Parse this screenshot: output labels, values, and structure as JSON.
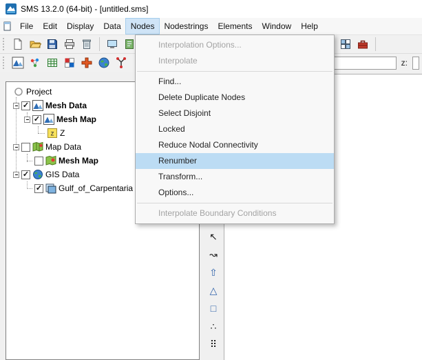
{
  "titlebar": {
    "title": "SMS 13.2.0 (64-bit) - [untitled.sms]"
  },
  "menubar": {
    "items": [
      "File",
      "Edit",
      "Display",
      "Data",
      "Nodes",
      "Nodestrings",
      "Elements",
      "Window",
      "Help"
    ]
  },
  "nodes_menu": {
    "items": [
      {
        "label": "Interpolation Options...",
        "state": "disabled"
      },
      {
        "label": "Interpolate",
        "state": "disabled"
      },
      {
        "label": "Find...",
        "state": "normal"
      },
      {
        "label": "Delete Duplicate Nodes",
        "state": "normal"
      },
      {
        "label": "Select Disjoint",
        "state": "normal"
      },
      {
        "label": "Locked",
        "state": "normal"
      },
      {
        "label": "Reduce Nodal Connectivity",
        "state": "normal"
      },
      {
        "label": "Renumber",
        "state": "highlighted"
      },
      {
        "label": "Transform...",
        "state": "normal"
      },
      {
        "label": "Options...",
        "state": "normal"
      },
      {
        "label": "Interpolate Boundary Conditions",
        "state": "disabled"
      }
    ]
  },
  "toolbar_right": {
    "z_label": "z:"
  },
  "tree": {
    "root": "Project",
    "items": [
      {
        "label": "Mesh Data",
        "checked": true,
        "bold": true
      },
      {
        "label": "Mesh Map",
        "checked": true,
        "bold": true
      },
      {
        "label": "Z",
        "checked": null,
        "bold": false
      },
      {
        "label": "Map Data",
        "checked": false,
        "bold": false
      },
      {
        "label": "Mesh Map",
        "checked": false,
        "bold": true
      },
      {
        "label": "GIS Data",
        "checked": true,
        "bold": false
      },
      {
        "label": "Gulf_of_Carpentaria",
        "checked": true,
        "bold": false
      }
    ]
  },
  "palette": {
    "tools": [
      {
        "name": "select-arrow-tool",
        "glyph": "↖"
      },
      {
        "name": "select-nodestring-tool",
        "glyph": "↝"
      },
      {
        "name": "create-node-tool",
        "glyph": "⇧"
      },
      {
        "name": "create-triangle-tool",
        "glyph": "△"
      },
      {
        "name": "create-quad-tool",
        "glyph": "□"
      },
      {
        "name": "vertex-points-tool",
        "glyph": "∴"
      },
      {
        "name": "grid-points-tool",
        "glyph": "⠿"
      }
    ]
  },
  "glyphs": {
    "check": "✓"
  },
  "colors": {
    "menu_highlight": "#bcdcf4",
    "selection_blue": "#cfe4f7",
    "toolbox_red": "#c0392b"
  }
}
